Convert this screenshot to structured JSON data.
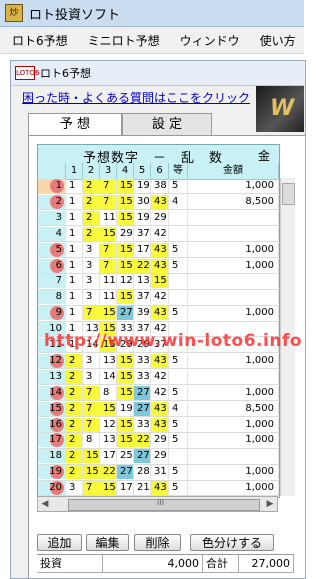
{
  "window": {
    "title": "ロト投資ソフト",
    "icon": "app-icon",
    "icon_glyph": "炒"
  },
  "menu": [
    "ロト6予想",
    "ミニロト予想",
    "ウィンドウ",
    "使い方"
  ],
  "child": {
    "title": "ロト6予想",
    "icon_text": "LOTO6"
  },
  "help_link": "困った時・よくある質問はここをクリック",
  "banner_text": "W",
  "tabs": {
    "yoso": "予 想",
    "settei": "設 定"
  },
  "grid": {
    "header_main": "予想数字　－　乱　数",
    "header_kingaku": "金額",
    "columns": [
      "",
      "1",
      "2",
      "3",
      "4",
      "5",
      "6",
      "等",
      "金額"
    ],
    "rows": [
      {
        "no": "1",
        "marked": true,
        "sel": true,
        "n": [
          "1",
          "2",
          "7",
          "15",
          "19",
          "38"
        ],
        "cls": [
          "",
          "y",
          "y",
          "y",
          "",
          ""
        ],
        "to": "5",
        "kin": "1,000"
      },
      {
        "no": "2",
        "marked": true,
        "sel": false,
        "n": [
          "1",
          "2",
          "7",
          "15",
          "30",
          "43"
        ],
        "cls": [
          "",
          "y",
          "y",
          "y",
          "",
          "y"
        ],
        "to": "4",
        "kin": "8,500"
      },
      {
        "no": "3",
        "marked": false,
        "sel": false,
        "n": [
          "1",
          "2",
          "11",
          "15",
          "19",
          "29"
        ],
        "cls": [
          "",
          "y",
          "",
          "y",
          "",
          ""
        ],
        "to": "",
        "kin": ""
      },
      {
        "no": "4",
        "marked": false,
        "sel": false,
        "n": [
          "1",
          "2",
          "15",
          "29",
          "37",
          "42"
        ],
        "cls": [
          "",
          "y",
          "y",
          "",
          "",
          ""
        ],
        "to": "",
        "kin": ""
      },
      {
        "no": "5",
        "marked": true,
        "sel": false,
        "n": [
          "1",
          "3",
          "7",
          "15",
          "17",
          "43"
        ],
        "cls": [
          "",
          "",
          "y",
          "y",
          "",
          "y"
        ],
        "to": "5",
        "kin": "1,000"
      },
      {
        "no": "6",
        "marked": true,
        "sel": false,
        "n": [
          "1",
          "3",
          "7",
          "15",
          "22",
          "43"
        ],
        "cls": [
          "",
          "",
          "y",
          "y",
          "y",
          "y"
        ],
        "to": "5",
        "kin": "1,000"
      },
      {
        "no": "7",
        "marked": false,
        "sel": false,
        "n": [
          "1",
          "3",
          "11",
          "12",
          "13",
          "15"
        ],
        "cls": [
          "",
          "",
          "",
          "",
          "",
          "y"
        ],
        "to": "",
        "kin": ""
      },
      {
        "no": "8",
        "marked": false,
        "sel": false,
        "n": [
          "1",
          "3",
          "11",
          "15",
          "37",
          "42"
        ],
        "cls": [
          "",
          "",
          "",
          "y",
          "",
          ""
        ],
        "to": "",
        "kin": ""
      },
      {
        "no": "9",
        "marked": true,
        "sel": false,
        "n": [
          "1",
          "7",
          "15",
          "27",
          "39",
          "43"
        ],
        "cls": [
          "",
          "y",
          "y",
          "b",
          "",
          "y"
        ],
        "to": "5",
        "kin": "1,000"
      },
      {
        "no": "10",
        "marked": false,
        "sel": false,
        "n": [
          "1",
          "13",
          "15",
          "33",
          "37",
          "42"
        ],
        "cls": [
          "",
          "",
          "y",
          "",
          "",
          ""
        ],
        "to": "",
        "kin": ""
      },
      {
        "no": "11",
        "marked": false,
        "sel": false,
        "n": [
          "1",
          "14",
          "15",
          "29",
          "29",
          "37"
        ],
        "cls": [
          "",
          "",
          "y",
          "",
          "",
          ""
        ],
        "to": "",
        "kin": ""
      },
      {
        "no": "12",
        "marked": true,
        "sel": false,
        "n": [
          "2",
          "3",
          "13",
          "15",
          "33",
          "43"
        ],
        "cls": [
          "y",
          "",
          "",
          "y",
          "",
          "y"
        ],
        "to": "5",
        "kin": "1,000"
      },
      {
        "no": "13",
        "marked": false,
        "sel": false,
        "n": [
          "2",
          "3",
          "14",
          "15",
          "33",
          "42"
        ],
        "cls": [
          "y",
          "",
          "",
          "y",
          "",
          ""
        ],
        "to": "",
        "kin": ""
      },
      {
        "no": "14",
        "marked": true,
        "sel": false,
        "n": [
          "2",
          "7",
          "8",
          "15",
          "27",
          "42"
        ],
        "cls": [
          "y",
          "y",
          "",
          "y",
          "b",
          ""
        ],
        "to": "5",
        "kin": "1,000"
      },
      {
        "no": "15",
        "marked": true,
        "sel": false,
        "n": [
          "2",
          "7",
          "15",
          "19",
          "27",
          "43"
        ],
        "cls": [
          "y",
          "y",
          "y",
          "",
          "b",
          "y"
        ],
        "to": "4",
        "kin": "8,500"
      },
      {
        "no": "16",
        "marked": true,
        "sel": false,
        "n": [
          "2",
          "7",
          "12",
          "15",
          "33",
          "43"
        ],
        "cls": [
          "y",
          "y",
          "",
          "y",
          "",
          "y"
        ],
        "to": "5",
        "kin": "1,000"
      },
      {
        "no": "17",
        "marked": true,
        "sel": false,
        "n": [
          "2",
          "8",
          "13",
          "15",
          "22",
          "29"
        ],
        "cls": [
          "y",
          "",
          "",
          "y",
          "y",
          ""
        ],
        "to": "5",
        "kin": "1,000"
      },
      {
        "no": "18",
        "marked": false,
        "sel": false,
        "n": [
          "2",
          "15",
          "17",
          "25",
          "27",
          "29"
        ],
        "cls": [
          "y",
          "y",
          "",
          "",
          "b",
          ""
        ],
        "to": "",
        "kin": ""
      },
      {
        "no": "19",
        "marked": true,
        "sel": false,
        "n": [
          "2",
          "15",
          "22",
          "27",
          "28",
          "31"
        ],
        "cls": [
          "y",
          "y",
          "y",
          "b",
          "",
          ""
        ],
        "to": "5",
        "kin": "1,000"
      },
      {
        "no": "20",
        "marked": true,
        "sel": false,
        "n": [
          "3",
          "7",
          "15",
          "17",
          "21",
          "43"
        ],
        "cls": [
          "",
          "y",
          "y",
          "",
          "",
          "y"
        ],
        "to": "5",
        "kin": "1,000"
      }
    ]
  },
  "scroll_marker": "III",
  "buttons": {
    "add": "追加",
    "edit": "編集",
    "delete": "削除",
    "color": "色分けする"
  },
  "summary": {
    "toushi_label": "投資",
    "toushi_value": "4,000",
    "goukei_label": "合計",
    "goukei_value": "27,000"
  },
  "watermark": "http://www.win-loto6.info",
  "colors": {
    "hit_yellow": "#f8f83c",
    "bonus_blue": "#7fc8dc",
    "marker_red": "#e57b7b",
    "header_cyan": "#c9f0f4"
  }
}
